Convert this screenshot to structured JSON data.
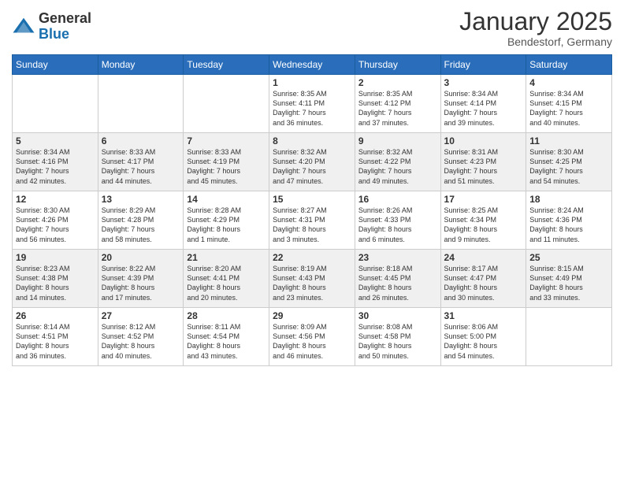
{
  "header": {
    "logo_general": "General",
    "logo_blue": "Blue",
    "month_title": "January 2025",
    "location": "Bendestorf, Germany"
  },
  "days_of_week": [
    "Sunday",
    "Monday",
    "Tuesday",
    "Wednesday",
    "Thursday",
    "Friday",
    "Saturday"
  ],
  "weeks": [
    [
      {
        "day": "",
        "info": ""
      },
      {
        "day": "",
        "info": ""
      },
      {
        "day": "",
        "info": ""
      },
      {
        "day": "1",
        "info": "Sunrise: 8:35 AM\nSunset: 4:11 PM\nDaylight: 7 hours\nand 36 minutes."
      },
      {
        "day": "2",
        "info": "Sunrise: 8:35 AM\nSunset: 4:12 PM\nDaylight: 7 hours\nand 37 minutes."
      },
      {
        "day": "3",
        "info": "Sunrise: 8:34 AM\nSunset: 4:14 PM\nDaylight: 7 hours\nand 39 minutes."
      },
      {
        "day": "4",
        "info": "Sunrise: 8:34 AM\nSunset: 4:15 PM\nDaylight: 7 hours\nand 40 minutes."
      }
    ],
    [
      {
        "day": "5",
        "info": "Sunrise: 8:34 AM\nSunset: 4:16 PM\nDaylight: 7 hours\nand 42 minutes."
      },
      {
        "day": "6",
        "info": "Sunrise: 8:33 AM\nSunset: 4:17 PM\nDaylight: 7 hours\nand 44 minutes."
      },
      {
        "day": "7",
        "info": "Sunrise: 8:33 AM\nSunset: 4:19 PM\nDaylight: 7 hours\nand 45 minutes."
      },
      {
        "day": "8",
        "info": "Sunrise: 8:32 AM\nSunset: 4:20 PM\nDaylight: 7 hours\nand 47 minutes."
      },
      {
        "day": "9",
        "info": "Sunrise: 8:32 AM\nSunset: 4:22 PM\nDaylight: 7 hours\nand 49 minutes."
      },
      {
        "day": "10",
        "info": "Sunrise: 8:31 AM\nSunset: 4:23 PM\nDaylight: 7 hours\nand 51 minutes."
      },
      {
        "day": "11",
        "info": "Sunrise: 8:30 AM\nSunset: 4:25 PM\nDaylight: 7 hours\nand 54 minutes."
      }
    ],
    [
      {
        "day": "12",
        "info": "Sunrise: 8:30 AM\nSunset: 4:26 PM\nDaylight: 7 hours\nand 56 minutes."
      },
      {
        "day": "13",
        "info": "Sunrise: 8:29 AM\nSunset: 4:28 PM\nDaylight: 7 hours\nand 58 minutes."
      },
      {
        "day": "14",
        "info": "Sunrise: 8:28 AM\nSunset: 4:29 PM\nDaylight: 8 hours\nand 1 minute."
      },
      {
        "day": "15",
        "info": "Sunrise: 8:27 AM\nSunset: 4:31 PM\nDaylight: 8 hours\nand 3 minutes."
      },
      {
        "day": "16",
        "info": "Sunrise: 8:26 AM\nSunset: 4:33 PM\nDaylight: 8 hours\nand 6 minutes."
      },
      {
        "day": "17",
        "info": "Sunrise: 8:25 AM\nSunset: 4:34 PM\nDaylight: 8 hours\nand 9 minutes."
      },
      {
        "day": "18",
        "info": "Sunrise: 8:24 AM\nSunset: 4:36 PM\nDaylight: 8 hours\nand 11 minutes."
      }
    ],
    [
      {
        "day": "19",
        "info": "Sunrise: 8:23 AM\nSunset: 4:38 PM\nDaylight: 8 hours\nand 14 minutes."
      },
      {
        "day": "20",
        "info": "Sunrise: 8:22 AM\nSunset: 4:39 PM\nDaylight: 8 hours\nand 17 minutes."
      },
      {
        "day": "21",
        "info": "Sunrise: 8:20 AM\nSunset: 4:41 PM\nDaylight: 8 hours\nand 20 minutes."
      },
      {
        "day": "22",
        "info": "Sunrise: 8:19 AM\nSunset: 4:43 PM\nDaylight: 8 hours\nand 23 minutes."
      },
      {
        "day": "23",
        "info": "Sunrise: 8:18 AM\nSunset: 4:45 PM\nDaylight: 8 hours\nand 26 minutes."
      },
      {
        "day": "24",
        "info": "Sunrise: 8:17 AM\nSunset: 4:47 PM\nDaylight: 8 hours\nand 30 minutes."
      },
      {
        "day": "25",
        "info": "Sunrise: 8:15 AM\nSunset: 4:49 PM\nDaylight: 8 hours\nand 33 minutes."
      }
    ],
    [
      {
        "day": "26",
        "info": "Sunrise: 8:14 AM\nSunset: 4:51 PM\nDaylight: 8 hours\nand 36 minutes."
      },
      {
        "day": "27",
        "info": "Sunrise: 8:12 AM\nSunset: 4:52 PM\nDaylight: 8 hours\nand 40 minutes."
      },
      {
        "day": "28",
        "info": "Sunrise: 8:11 AM\nSunset: 4:54 PM\nDaylight: 8 hours\nand 43 minutes."
      },
      {
        "day": "29",
        "info": "Sunrise: 8:09 AM\nSunset: 4:56 PM\nDaylight: 8 hours\nand 46 minutes."
      },
      {
        "day": "30",
        "info": "Sunrise: 8:08 AM\nSunset: 4:58 PM\nDaylight: 8 hours\nand 50 minutes."
      },
      {
        "day": "31",
        "info": "Sunrise: 8:06 AM\nSunset: 5:00 PM\nDaylight: 8 hours\nand 54 minutes."
      },
      {
        "day": "",
        "info": ""
      }
    ]
  ]
}
